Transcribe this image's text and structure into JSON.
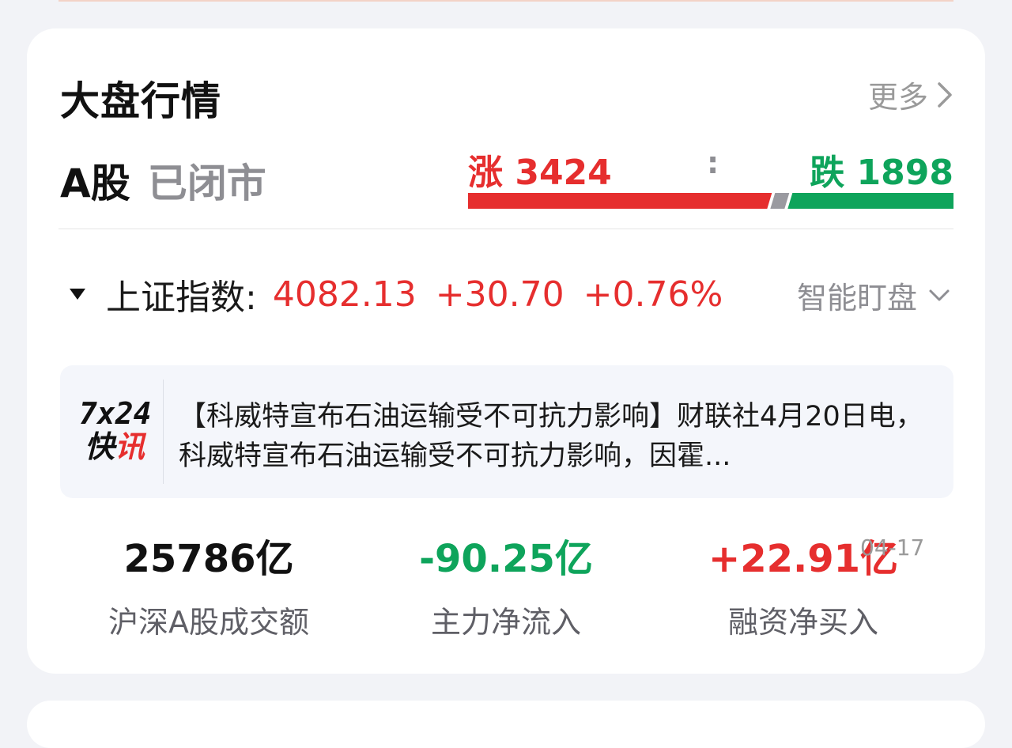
{
  "section": {
    "title": "大盘行情",
    "more_label": "更多"
  },
  "market": {
    "name": "A股",
    "status": "已闭市",
    "rise_label": "涨",
    "rise_count": "3424",
    "separator": ":",
    "fall_label": "跌",
    "fall_count": "1898",
    "rise_fraction": 0.6434,
    "fall_fraction": 0.3566
  },
  "index": {
    "name": "上证指数:",
    "value": "4082.13",
    "change": "+30.70",
    "change_pct": "+0.76%",
    "smart_watch_label": "智能盯盘"
  },
  "news": {
    "logo_line1": "7x24",
    "logo_line2_a": "快",
    "logo_line2_b": "讯",
    "text": "【科威特宣布石油运输受不可抗力影响】财联社4月20日电，科威特宣布石油运输受不可抗力影响，因霍..."
  },
  "stats": [
    {
      "value": "25786亿",
      "label": "沪深A股成交额",
      "color": "#111111"
    },
    {
      "value": "-90.25亿",
      "label": "主力净流入",
      "color": "#0ea45b"
    },
    {
      "value": "+22.91亿",
      "label": "融资净买入",
      "color": "#e62e2e"
    }
  ],
  "stats_date": "04-17",
  "colors": {
    "rise": "#e62e2e",
    "fall": "#0ea45b",
    "neutral": "#9a9aa0"
  }
}
